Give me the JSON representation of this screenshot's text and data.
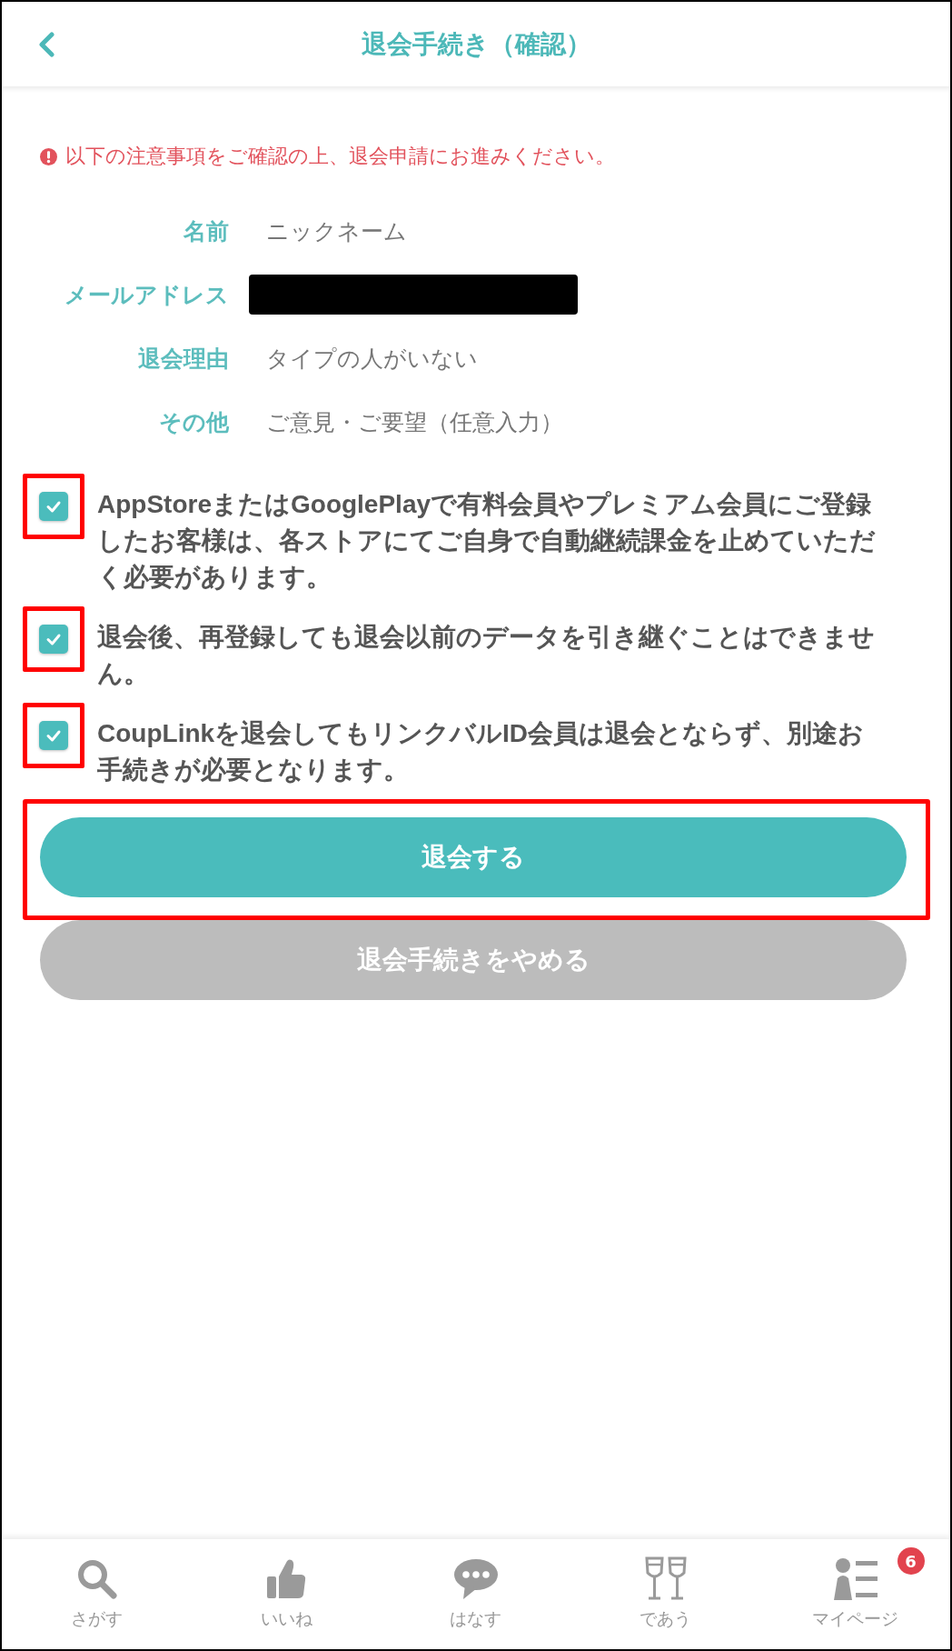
{
  "header": {
    "title": "退会手続き（確認）"
  },
  "notice": {
    "text": "以下の注意事項をご確認の上、退会申請にお進みください。"
  },
  "fields": [
    {
      "kind": "text",
      "label": "名前",
      "value": "ニックネーム"
    },
    {
      "kind": "redacted",
      "label": "メールアドレス"
    },
    {
      "kind": "text",
      "label": "退会理由",
      "value": "タイプの人がいない"
    },
    {
      "kind": "text",
      "label": "その他",
      "value": "ご意見・ご要望（任意入力）"
    }
  ],
  "agreements": [
    {
      "text": "AppStoreまたはGooglePlayで有料会員やプレミアム会員にご登録したお客様は、各ストアにてご自身で自動継続課金を止めていただく必要があります。",
      "checked": true,
      "highlighted": true
    },
    {
      "text": "退会後、再登録しても退会以前のデータを引き継ぐことはできません。",
      "checked": true,
      "highlighted": true
    },
    {
      "text": "CoupLinkを退会してもリンクバルID会員は退会とならず、別途お手続きが必要となります。",
      "checked": true,
      "highlighted": true
    }
  ],
  "buttons": [
    {
      "kind": "primary",
      "label": "退会する",
      "highlighted": true
    },
    {
      "kind": "secondary",
      "label": "退会手続きをやめる",
      "highlighted": false
    }
  ],
  "bottom_nav": [
    {
      "kind": "search",
      "label": "さがす"
    },
    {
      "kind": "like",
      "label": "いいね"
    },
    {
      "kind": "talk",
      "label": "はなす"
    },
    {
      "kind": "meet",
      "label": "であう"
    },
    {
      "kind": "mypage",
      "label": "マイページ",
      "badge": "6"
    }
  ]
}
